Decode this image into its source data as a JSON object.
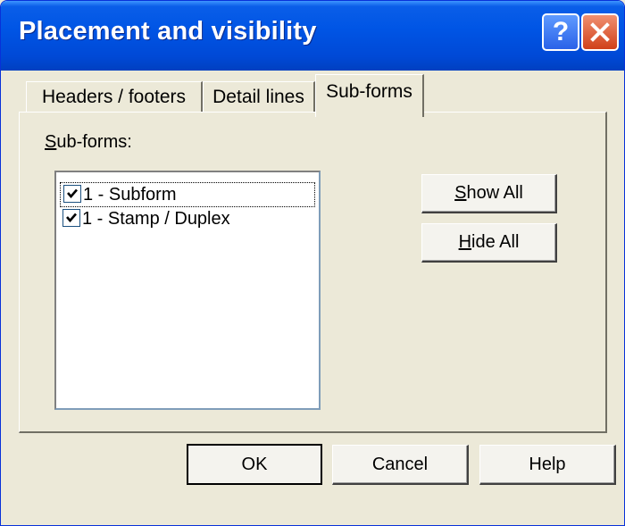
{
  "window": {
    "title": "Placement and visibility"
  },
  "titlebar": {
    "help_label": "?",
    "close_icon": "close-icon"
  },
  "tabs": [
    {
      "label": "Headers / footers",
      "active": false
    },
    {
      "label": "Detail lines",
      "active": false
    },
    {
      "label": "Sub-forms",
      "active": true
    }
  ],
  "subforms": {
    "label_accel": "S",
    "label_rest": "ub-forms:",
    "items": [
      {
        "label": "1 - Subform",
        "checked": true,
        "focused": true
      },
      {
        "label": "1 - Stamp / Duplex",
        "checked": true,
        "focused": false
      }
    ],
    "show_all": {
      "accel": "S",
      "rest": "how All"
    },
    "hide_all": {
      "accel": "H",
      "rest": "ide All"
    }
  },
  "buttons": {
    "ok": "OK",
    "cancel": "Cancel",
    "help": "Help"
  },
  "colors": {
    "title_bar": "#0055e5",
    "dialog_bg": "#ece9d8",
    "close_button": "#d0401a"
  }
}
